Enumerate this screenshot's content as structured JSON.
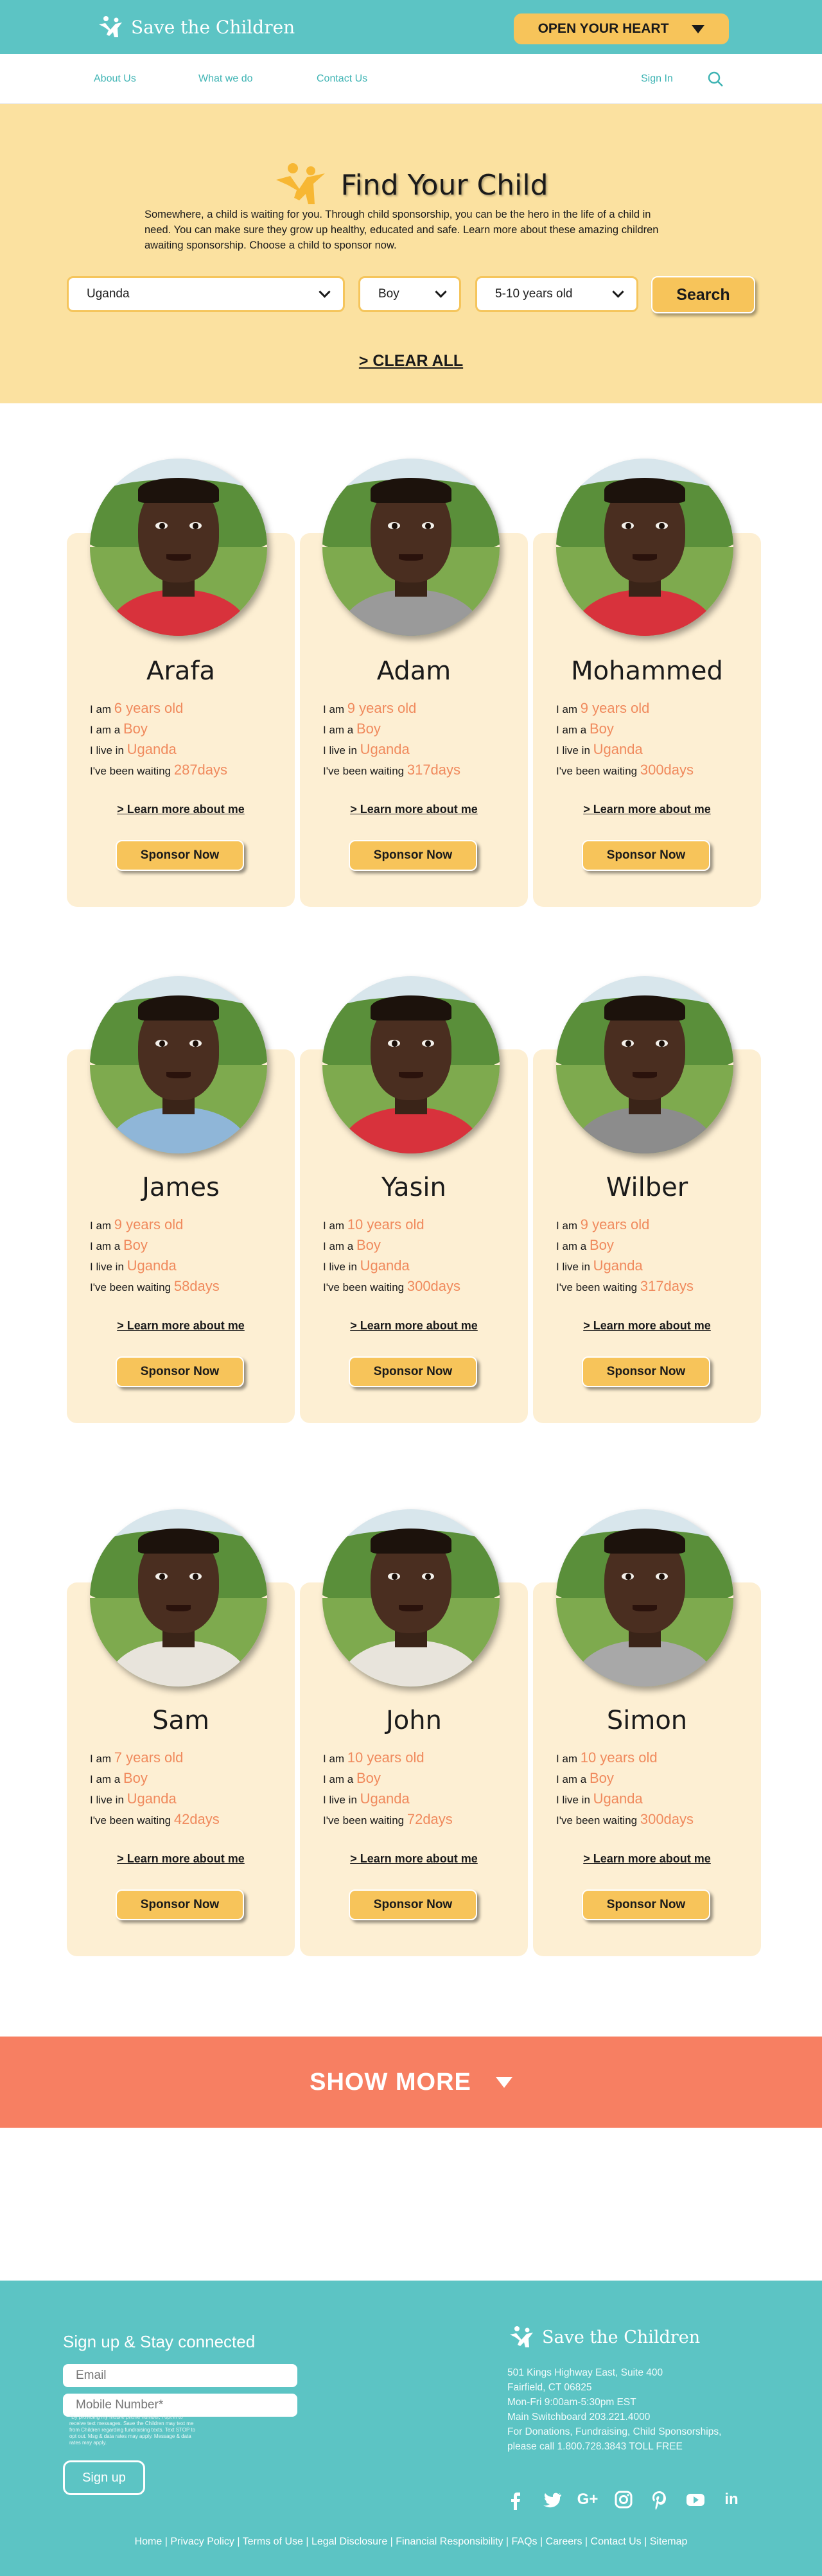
{
  "header": {
    "brand": "Save the Children",
    "heart_button": "OPEN YOUR HEART"
  },
  "nav": {
    "about": "About Us",
    "what": "What we do",
    "contact": "Contact Us",
    "signin": "Sign In"
  },
  "hero": {
    "title": "Find Your Child",
    "description": "Somewhere, a child is waiting for you. Through child sponsorship, you can be the hero in the life of a child in need. You can make sure they grow up healthy, educated and safe. Learn more about these amazing children awaiting sponsorship. Choose a child to sponsor now.",
    "country": "Uganda",
    "gender": "Boy",
    "age": "5-10 years old",
    "search_label": "Search",
    "clear_all": "> CLEAR ALL"
  },
  "labels": {
    "i_am": "I am",
    "i_am_a": "I am a",
    "i_live_in": "I live in",
    "waiting": "I've been waiting",
    "learn": "> Learn more about me",
    "sponsor": "Sponsor Now"
  },
  "children": [
    {
      "name": "Arafa",
      "age": "6 years old",
      "gender": "Boy",
      "country": "Uganda",
      "days": "287days",
      "shirt": "#d8323c"
    },
    {
      "name": "Adam",
      "age": "9 years old",
      "gender": "Boy",
      "country": "Uganda",
      "days": "317days",
      "shirt": "#9a9a9a"
    },
    {
      "name": "Mohammed",
      "age": "9 years old",
      "gender": "Boy",
      "country": "Uganda",
      "days": "300days",
      "shirt": "#d8323c"
    },
    {
      "name": "James",
      "age": "9 years old",
      "gender": "Boy",
      "country": "Uganda",
      "days": "58days",
      "shirt": "#8fb6d8"
    },
    {
      "name": "Yasin",
      "age": "10 years old",
      "gender": "Boy",
      "country": "Uganda",
      "days": "300days",
      "shirt": "#d8323c"
    },
    {
      "name": "Wilber",
      "age": "9 years old",
      "gender": "Boy",
      "country": "Uganda",
      "days": "317days",
      "shirt": "#8c8c8c"
    },
    {
      "name": "Sam",
      "age": "7 years old",
      "gender": "Boy",
      "country": "Uganda",
      "days": "42days",
      "shirt": "#e8e4dc"
    },
    {
      "name": "John",
      "age": "10 years old",
      "gender": "Boy",
      "country": "Uganda",
      "days": "72days",
      "shirt": "#e8e4dc"
    },
    {
      "name": "Simon",
      "age": "10 years old",
      "gender": "Boy",
      "country": "Uganda",
      "days": "300days",
      "shirt": "#a8a8a8"
    }
  ],
  "show_more": "SHOW MORE",
  "footer": {
    "signup_title": "Sign up & Stay connected",
    "email_placeholder": "Email",
    "mobile_placeholder": "Mobile Number*",
    "fine_print": "*By providing my mobile phone number, I opt in to receive text messages. Save the Children may text me from Children regarding fundraising texts. Text STOP to opt out. Msg & data rates may apply. Message & data rates may apply.",
    "signup_button": "Sign up",
    "brand": "Save the Children",
    "address": [
      "501 Kings Highway East, Suite 400",
      "Fairfield, CT 06825",
      "Mon-Fri 9:00am-5:30pm EST",
      "Main Switchboard 203.221.4000",
      "For Donations, Fundraising, Child Sponsorships,",
      "please call 1.800.728.3843 TOLL FREE"
    ],
    "social": [
      "f",
      "t",
      "G+",
      "ig",
      "p",
      "yt",
      "in"
    ],
    "links": [
      "Home",
      "Privacy Policy",
      "Terms of Use",
      "Legal Disclosure",
      "Financial Responsibility",
      "FAQs",
      "Careers",
      "Contact Us",
      "Sitemap"
    ]
  },
  "colors": {
    "teal": "#5cc4c4",
    "yellow": "#f7c45a",
    "cream": "#fbe1a0",
    "card": "#fdefd3",
    "accent": "#f08a5d",
    "show_more": "#f77f62"
  }
}
